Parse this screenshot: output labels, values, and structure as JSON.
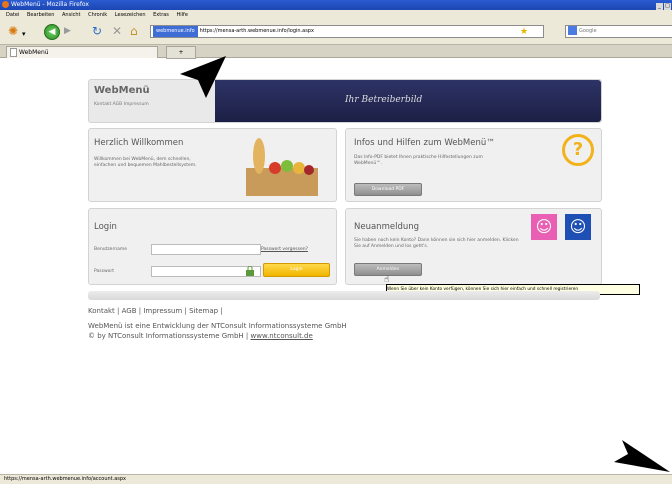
{
  "window": {
    "title": "WebMenü - Mozilla Firefox"
  },
  "menu": [
    "Datei",
    "Bearbeiten",
    "Ansicht",
    "Chronik",
    "Lesezeichen",
    "Extras",
    "Hilfe"
  ],
  "urlbar": {
    "site_label": "webmenue.info",
    "url": "https://mensa-arth.webmenue.info/login.aspx"
  },
  "searchbar": {
    "engine": "Google"
  },
  "tab": {
    "label": "WebMenü",
    "add": "+"
  },
  "header": {
    "brand": "WebMenü",
    "links": [
      "Kontakt",
      "AGB",
      "Impressum"
    ],
    "tagline": "Ihr Betreiberbild"
  },
  "welcome": {
    "title": "Herzlich Willkommen",
    "text": "Willkommen bei WebMenü, dem schnellen, einfachen und bequemen Mahlbestellsystem."
  },
  "info": {
    "title": "Infos und Hilfen zum WebMenü™",
    "text": "Das Info-PDF bietet Ihnen praktische Hilfestellungen zum WebMenü™.",
    "button": "Download PDF"
  },
  "login": {
    "title": "Login",
    "username_label": "Benutzername",
    "username_value": "",
    "password_label": "Passwort",
    "password_value": "",
    "forgot_link": "Passwort vergessen?",
    "submit": "Login"
  },
  "register": {
    "title": "Neuanmeldung",
    "text": "Sie haben noch kein Konto? Dann können sie sich hier anmelden. Klicken Sie auf Anmelden und los geht's.",
    "button": "Anmelden",
    "tooltip": "Wenn Sie über kein Konto verfügen, können Sie sich hier einfach und schnell registrieren"
  },
  "footer": {
    "links": [
      "Kontakt",
      "AGB",
      "Impressum",
      "Sitemap"
    ],
    "line1": "WebMenü ist eine Entwicklung der NTConsult Informationssysteme GmbH",
    "line2_prefix": "© by NTConsult Informationssysteme GmbH |",
    "line2_link": "www.ntconsult.de"
  },
  "status": {
    "url": "https://mensa-arth.webmenue.info/account.aspx"
  },
  "colors": {
    "header_bar": "#262a58",
    "accent_yellow": "#f6c30a",
    "pink": "#e85fb4",
    "blue": "#1e4fb4"
  }
}
